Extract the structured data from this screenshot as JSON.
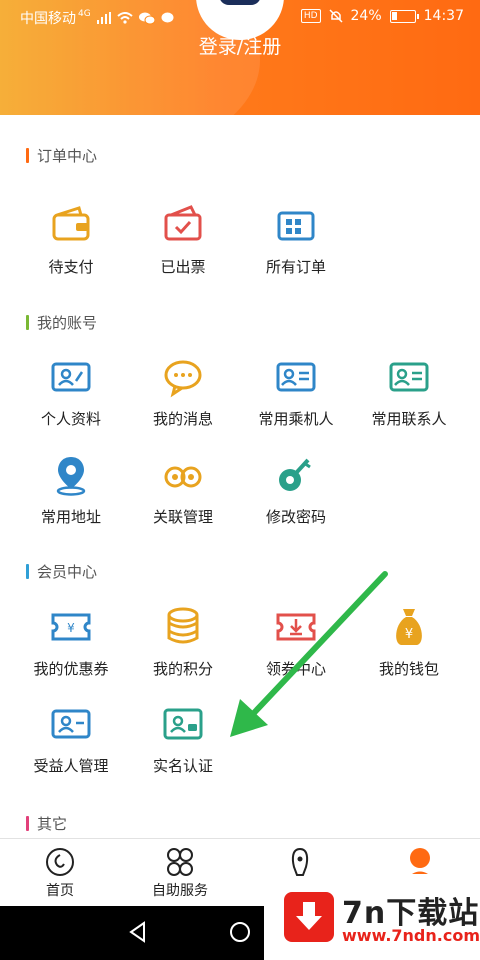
{
  "status_bar": {
    "carrier": "中国移动",
    "network": "4G",
    "hd_badge": "HD",
    "battery_percent": "24%",
    "battery_level": 0.24,
    "time": "14:37"
  },
  "header": {
    "login_label": "登录/注册"
  },
  "sections": {
    "orders": {
      "title": "订单中心",
      "accent": "#ff6a12",
      "items": [
        {
          "label": "待支付",
          "icon": "wallet-icon",
          "color": "#e8a31f"
        },
        {
          "label": "已出票",
          "icon": "ticket-check-icon",
          "color": "#e2504b"
        },
        {
          "label": "所有订单",
          "icon": "ticket-grid-icon",
          "color": "#2f86c8"
        }
      ]
    },
    "account": {
      "title": "我的账号",
      "accent": "#7ab834",
      "items": [
        {
          "label": "个人资料",
          "icon": "profile-card-icon",
          "color": "#2f86c8"
        },
        {
          "label": "我的消息",
          "icon": "message-bubble-icon",
          "color": "#e8a31f"
        },
        {
          "label": "常用乘机人",
          "icon": "passenger-card-icon",
          "color": "#2f86c8"
        },
        {
          "label": "常用联系人",
          "icon": "contact-card-icon",
          "color": "#2aa08a"
        },
        {
          "label": "常用地址",
          "icon": "location-pin-icon",
          "color": "#2f86c8"
        },
        {
          "label": "关联管理",
          "icon": "link-icon",
          "color": "#e8a31f"
        },
        {
          "label": "修改密码",
          "icon": "key-icon",
          "color": "#2aa08a"
        }
      ]
    },
    "membership": {
      "title": "会员中心",
      "accent": "#2f9fd6",
      "items": [
        {
          "label": "我的优惠券",
          "icon": "coupon-icon",
          "color": "#2f86c8"
        },
        {
          "label": "我的积分",
          "icon": "coins-icon",
          "color": "#e8a31f"
        },
        {
          "label": "领券中心",
          "icon": "coupon-download-icon",
          "color": "#e2504b"
        },
        {
          "label": "我的钱包",
          "icon": "money-bag-icon",
          "color": "#e8a31f"
        },
        {
          "label": "受益人管理",
          "icon": "beneficiary-card-icon",
          "color": "#2f86c8"
        },
        {
          "label": "实名认证",
          "icon": "id-verify-icon",
          "color": "#2aa08a"
        }
      ]
    },
    "other": {
      "title": "其它",
      "accent": "#e2407a"
    }
  },
  "tab_bar": {
    "tabs": [
      {
        "label": "首页",
        "icon": "home-icon"
      },
      {
        "label": "自助服务",
        "icon": "self-service-icon"
      },
      {
        "label": "",
        "icon": "service-icon"
      },
      {
        "label": "",
        "icon": "profile-icon",
        "active": true
      }
    ],
    "active_color": "#ff6a12"
  },
  "watermark": {
    "name": "7n下载站",
    "url": "www.7ndn.com"
  },
  "annotation": {
    "arrow_color": "#2fb84a"
  }
}
